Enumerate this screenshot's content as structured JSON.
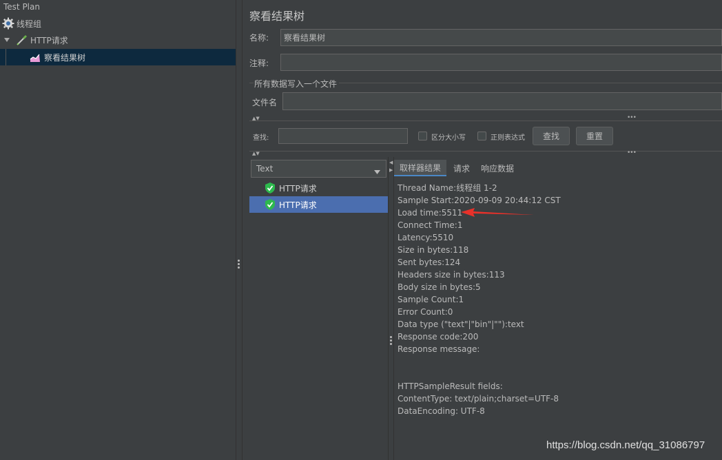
{
  "tree": {
    "root_label": "Test Plan",
    "items": [
      {
        "label": "线程组",
        "icon": "gear-icon"
      },
      {
        "label": "HTTP请求",
        "icon": "pipette-icon"
      },
      {
        "label": "察看结果树",
        "icon": "graph-icon"
      }
    ]
  },
  "panel": {
    "title": "察看结果树",
    "name_label": "名称:",
    "name_value": "察看结果树",
    "comment_label": "注释:",
    "comment_value": "",
    "group_label": "所有数据写入一个文件",
    "file_label": "文件名",
    "file_value": ""
  },
  "search": {
    "label": "查找:",
    "value": "",
    "case_label": "区分大小写",
    "regex_label": "正则表达式",
    "find_button": "查找",
    "reset_button": "重置"
  },
  "renderer": {
    "selected": "Text"
  },
  "results": [
    {
      "label": "HTTP请求",
      "status": "success"
    },
    {
      "label": "HTTP请求",
      "status": "success",
      "selected": true
    }
  ],
  "tabs": [
    {
      "label": "取样器结果",
      "active": true
    },
    {
      "label": "请求",
      "active": false
    },
    {
      "label": "响应数据",
      "active": false
    }
  ],
  "sampler_result": [
    "Thread Name:线程组 1-2",
    "Sample Start:2020-09-09 20:44:12 CST",
    "Load time:5511",
    "Connect Time:1",
    "Latency:5510",
    "Size in bytes:118",
    "Sent bytes:124",
    "Headers size in bytes:113",
    "Body size in bytes:5",
    "Sample Count:1",
    "Error Count:0",
    "Data type (\"text\"|\"bin\"|\"\"):text",
    "Response code:200",
    "Response message:",
    "",
    "",
    "HTTPSampleResult fields:",
    "ContentType: text/plain;charset=UTF-8",
    "DataEncoding: UTF-8"
  ],
  "watermark": "https://blog.csdn.net/qq_31086797",
  "colors": {
    "background": "#3c3f41",
    "selection_tree": "#0d293e",
    "selection_list": "#4b6eaf",
    "success": "#2db94d",
    "annotation_arrow": "#e8312a"
  }
}
